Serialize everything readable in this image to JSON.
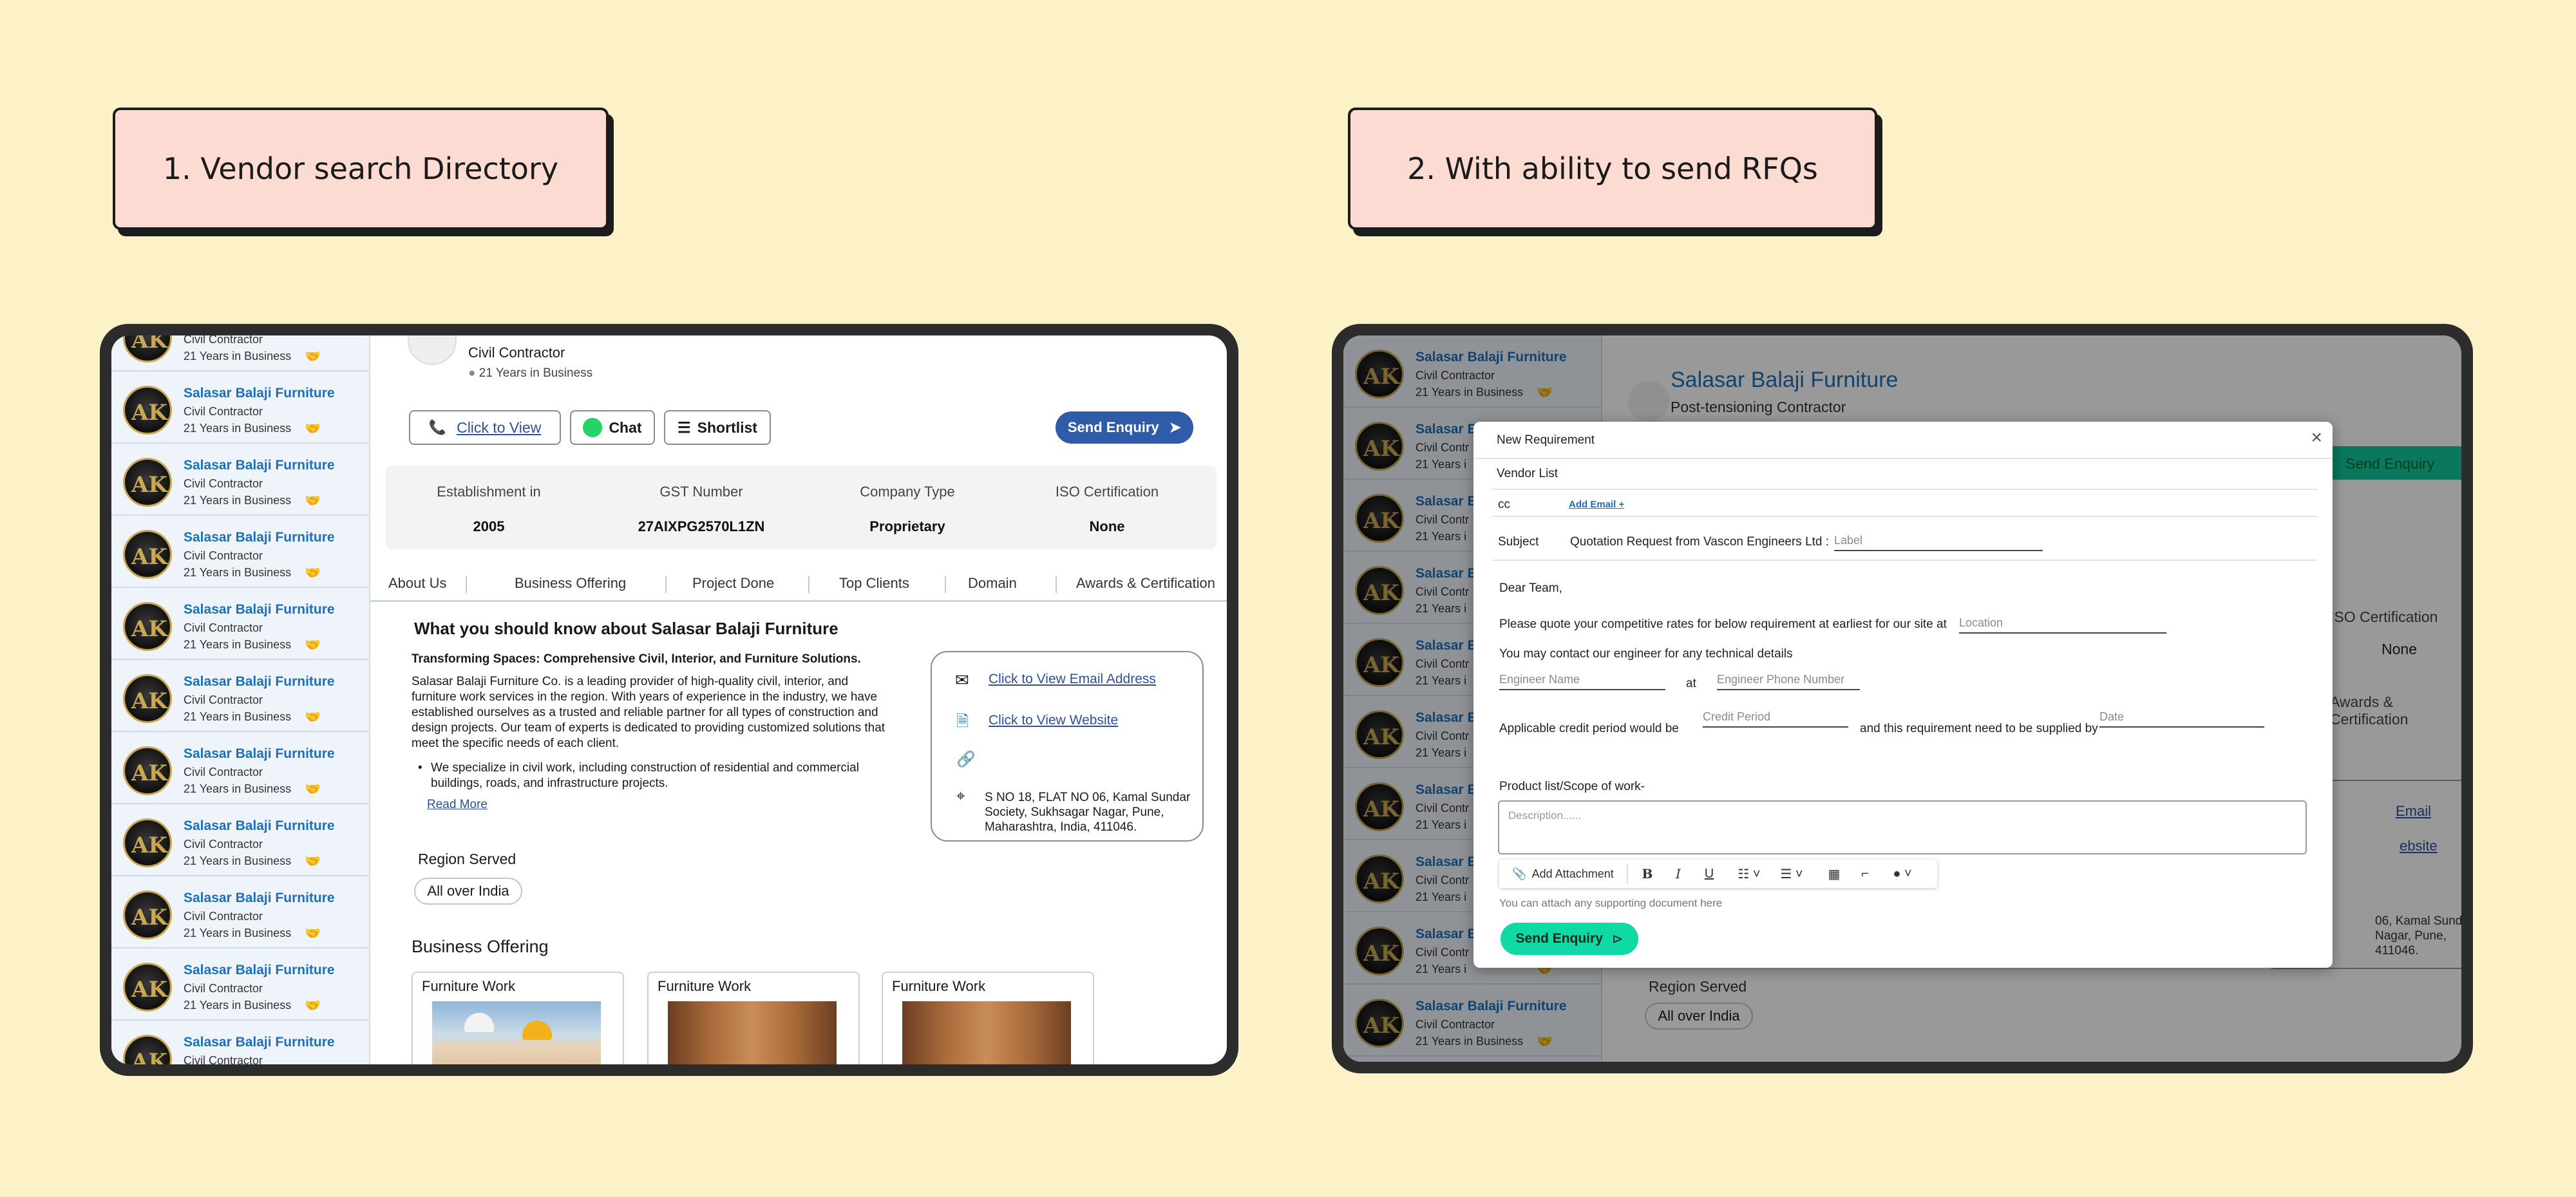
{
  "labels": {
    "left": "1. Vendor search Directory",
    "right": "2. With ability to send RFQs"
  },
  "vendor": {
    "name": "Salasar Balaji Furniture",
    "type": "Civil Contractor",
    "years": "21 Years in Business"
  },
  "left_panel": {
    "header_type": "Civil Contractor",
    "header_years": "21 Years in Business",
    "actions": {
      "click_to_view": "Click to View",
      "chat": "Chat",
      "shortlist": "Shortlist",
      "send_enquiry": "Send Enquiry"
    },
    "info": [
      {
        "label": "Establishment in",
        "value": "2005"
      },
      {
        "label": "GST Number",
        "value": "27AIXPG2570L1ZN"
      },
      {
        "label": "Company Type",
        "value": "Proprietary"
      },
      {
        "label": "ISO Certification",
        "value": "None"
      }
    ],
    "tabs": [
      "About Us",
      "Business Offering",
      "Project Done",
      "Top Clients",
      "Domain",
      "Awards & Certification"
    ],
    "about": {
      "heading": "What you should know about Salasar Balaji Furniture",
      "subheading": "Transforming Spaces: Comprehensive Civil, Interior, and Furniture Solutions.",
      "paragraph": "Salasar Balaji Furniture Co. is a leading provider of high-quality civil, interior, and furniture work services in the region. With years of experience in the industry, we have established ourselves as a trusted and reliable partner for all types of construction and design projects. Our team of experts is dedicated to providing customized solutions that meet the specific needs of each client.",
      "bullet": "We specialize in civil work, including construction of residential and commercial buildings, roads, and infrastructure projects.",
      "read_more": "Read More"
    },
    "contact": {
      "email": "Click to View Email Address",
      "website": "Click to View Website",
      "address": "S NO 18, FLAT NO 06, Kamal Sundar Society, Sukhsagar Nagar, Pune, Maharashtra, India, 411046."
    },
    "region": {
      "heading": "Region Served",
      "value": "All over India"
    },
    "business_offering": {
      "heading": "Business Offering",
      "cards": [
        "Furniture Work",
        "Furniture Work",
        "Furniture Work"
      ]
    }
  },
  "right_panel": {
    "vendor_subtype": "Post-tensioning Contractor",
    "bg_send": "Send Enquiry",
    "bg_iso": "ISO Certification",
    "bg_iso_value": "None",
    "bg_tab": "Awards & Certification",
    "bg_email": "Email",
    "bg_website": "ebsite",
    "bg_address": "06, Kamal Sundar Nagar, Pune, 411046.",
    "bg_region": "Region Served",
    "bg_region_value": "All over India",
    "bg_truncated": "Civil Contr",
    "bg_truncated_years": "21 Years i",
    "bg_truncated_name": "Salasar E",
    "modal": {
      "title": "New Requirement",
      "vendor_list": "Vendor List",
      "cc": "cc",
      "add_email": "Add Email +",
      "subject_label": "Subject",
      "subject_value": "Quotation Request from Vascon Engineers Ltd :",
      "subject_placeholder": "Label",
      "greeting": "Dear Team,",
      "line1": "Please quote your competitive rates for below requirement at earliest for our site at",
      "location_placeholder": "Location",
      "line2": "You may contact our engineer for any technical details",
      "engineer_name": "Engineer Name",
      "at": "at",
      "engineer_phone": "Engineer Phone Number",
      "credit_text": "Applicable credit period would be",
      "credit_placeholder": "Credit Period",
      "supply_text": "and  this requirement need to be supplied by",
      "date_placeholder": "Date",
      "scope_label": "Product list/Scope of work-",
      "description_placeholder": "Description......",
      "add_attachment": "Add Attachment",
      "attach_hint": "You can attach any supporting document here",
      "send": "Send Enquiry"
    }
  }
}
